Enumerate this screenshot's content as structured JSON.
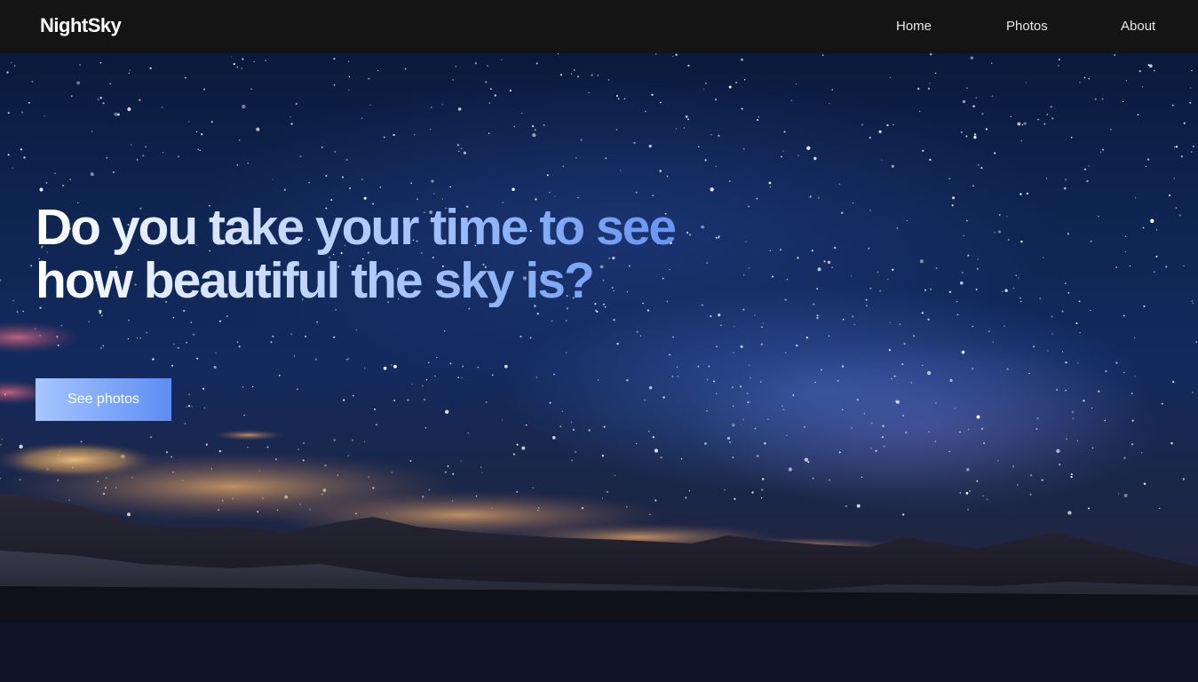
{
  "brand": "NightSky",
  "nav": {
    "home": "Home",
    "photos": "Photos",
    "about": "About"
  },
  "hero": {
    "headline": "Do you take your time to see how beautiful the sky is?",
    "cta_label": "See photos"
  },
  "colors": {
    "navbar": "#141414",
    "page_bg": "#0d1426",
    "accent_start": "#a7c6ff",
    "accent_end": "#5d8cf4"
  }
}
